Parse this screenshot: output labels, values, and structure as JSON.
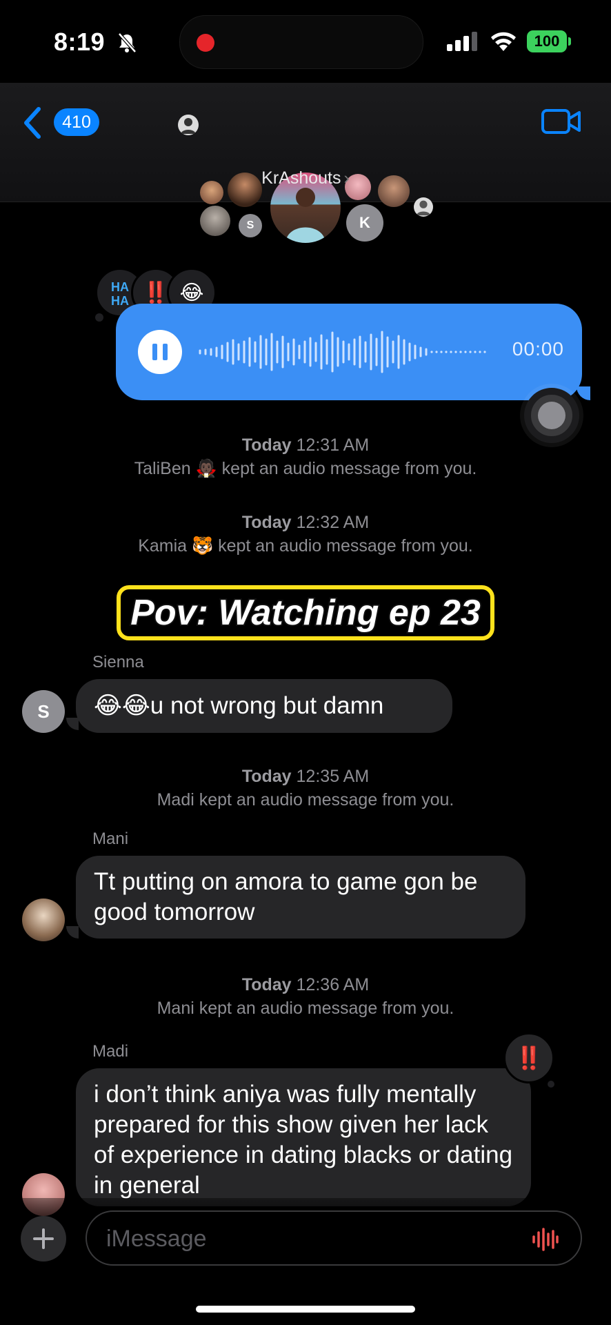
{
  "status_bar": {
    "time": "8:19",
    "battery": "100"
  },
  "header": {
    "unread_count": "410",
    "group_name": "KrAshouts",
    "avatar_letters": [
      "S",
      "K"
    ]
  },
  "audio_message": {
    "duration": "00:00",
    "reactions": [
      "HA HA",
      "‼️",
      "😂"
    ]
  },
  "events": [
    {
      "time_prefix": "Today",
      "time": "12:31 AM",
      "text": "TaliBen 🧛🏿 kept an audio message from you."
    },
    {
      "time_prefix": "Today",
      "time": "12:32 AM",
      "text": "Kamia 🐯  kept an audio message from you."
    },
    {
      "time_prefix": "Today",
      "time": "12:35 AM",
      "text": "Madi kept an audio message from you."
    },
    {
      "time_prefix": "Today",
      "time": "12:36 AM",
      "text": "Mani  kept an audio message from you."
    }
  ],
  "overlay_caption": "Pov: Watching ep 23",
  "messages": [
    {
      "sender": "Sienna",
      "avatar_letter": "S",
      "text": "😂😂u not wrong but damn"
    },
    {
      "sender": "Mani",
      "text": "Tt putting on amora to game gon be good tomorrow"
    },
    {
      "sender": "Madi",
      "text": "i don’t think aniya was fully mentally prepared for this show given her lack of experience in dating blacks or dating in general",
      "reaction": "‼️"
    }
  ],
  "composer": {
    "placeholder": "iMessage"
  },
  "colors": {
    "accent": "#0a84ff",
    "bubble_out": "#3b8ff5",
    "bubble_in": "#262628",
    "battery": "#3cd25d",
    "caption_border": "#ffe21c"
  }
}
